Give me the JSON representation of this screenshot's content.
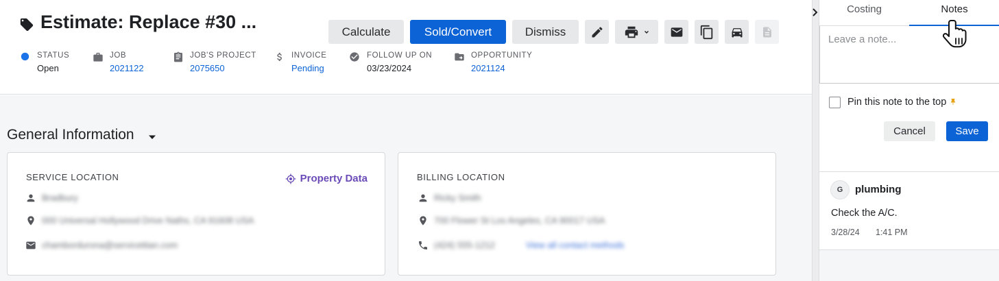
{
  "estimate": {
    "title": "Estimate: Replace #30 ...",
    "actions": {
      "calculate": "Calculate",
      "sold_convert": "Sold/Convert",
      "dismiss": "Dismiss"
    },
    "meta": [
      {
        "label": "STATUS",
        "value": "Open",
        "icon": "status-dot-icon",
        "color": "#1a73e8"
      },
      {
        "label": "JOB",
        "value": "2021122",
        "icon": "briefcase-icon"
      },
      {
        "label": "JOB'S PROJECT",
        "value": "2075650",
        "icon": "clipboard-icon"
      },
      {
        "label": "INVOICE",
        "value": "Pending",
        "icon": "dollar-icon"
      },
      {
        "label": "FOLLOW UP ON",
        "value": "03/23/2024",
        "icon": "check-circle-icon"
      },
      {
        "label": "OPPORTUNITY",
        "value": "2021124",
        "icon": "folder-icon"
      }
    ]
  },
  "general_info": {
    "title": "General Information",
    "service_location": {
      "title": "SERVICE LOCATION",
      "property_data": "Property Data",
      "name": "Bradbury",
      "address": "000 Universal Hollywood Drive Naths, CA 91608 USA",
      "email": "chambordurona@servicetitan.com"
    },
    "billing_location": {
      "title": "BILLING LOCATION",
      "name": "Ricky Smith",
      "address": "700 Flower St Los Angeles, CA 90017 USA",
      "phone": "(424) 555-1212",
      "contact_link": "View all contact methods"
    }
  },
  "panel": {
    "tabs": [
      "Costing",
      "Notes"
    ],
    "active_tab": "Notes",
    "note_placeholder": "Leave a note...",
    "pin_label": "Pin this note to the top",
    "cancel": "Cancel",
    "save": "Save",
    "note": {
      "avatar": "G",
      "author": "plumbing",
      "text": "Check the A/C.",
      "date": "3/28/24",
      "time": "1:41 PM"
    }
  },
  "colors": {
    "primary": "#0c63d6",
    "link": "#0c63d6",
    "property_data": "#6b4bb8",
    "pin": "#e8a317"
  }
}
